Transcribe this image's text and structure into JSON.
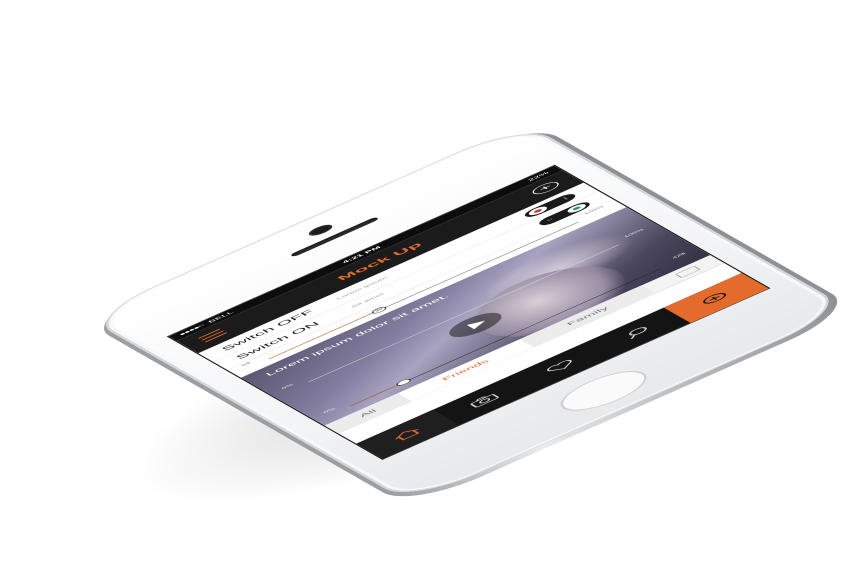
{
  "status_bar": {
    "carrier": "BELL",
    "time": "4:21 PM",
    "battery": "22%"
  },
  "header": {
    "title": "Mock Up"
  },
  "settings": {
    "switch_off": {
      "label": "Switch OFF",
      "sub": "Lorem ipsum"
    },
    "switch_on": {
      "label": "Switch ON",
      "sub": "Sit amet"
    }
  },
  "sliders": {
    "top": {
      "min": "0$",
      "value": "30",
      "max": "100%"
    },
    "middle": {
      "min": "0%",
      "max": "100%"
    },
    "bottom": {
      "min": "0%",
      "max": "42$"
    }
  },
  "card": {
    "caption": "Lorem ipsum dolor sit amet."
  },
  "tabs": {
    "all": "All",
    "friends": "Friends",
    "family": "Family"
  },
  "colors": {
    "accent": "#e46b2b",
    "bar": "#141414"
  }
}
